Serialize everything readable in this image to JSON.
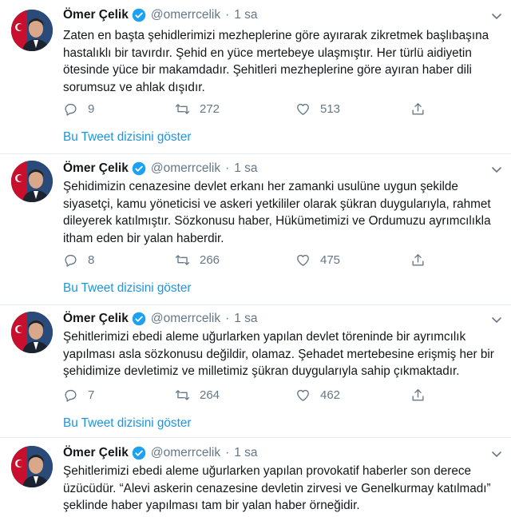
{
  "tweets": [
    {
      "name": "Ömer Çelik",
      "handle": "@omerrcelik",
      "separator": "·",
      "time": "1 sa",
      "text": "Zaten en başta şehidlerimizi mezheplerine göre ayırarak zikretmek başlıbaşına hastalıklı bir tavırdır. Şehid en yüce mertebeye ulaşmıştır. Her türlü aidiyetin ötesinde yüce bir makamdadır. Şehitleri mezheplerine göre ayıran  haber dili sorumsuz ve ahlak dışıdır.",
      "replies": "9",
      "retweets": "272",
      "likes": "513",
      "thread_link": "Bu Tweet dizisini göster"
    },
    {
      "name": "Ömer Çelik",
      "handle": "@omerrcelik",
      "separator": "·",
      "time": "1 sa",
      "text": "Şehidimizin cenazesine devlet erkanı her zamanki usulüne uygun şekilde siyasetçi, kamu yöneticisi ve askeri yetkililer olarak şükran duygularıyla, rahmet dileyerek katılmıştır. Sözkonusu haber, Hükümetimizi ve Ordumuzu ayrımcılıkla itham eden bir yalan haberdir.",
      "replies": "8",
      "retweets": "266",
      "likes": "475",
      "thread_link": "Bu Tweet dizisini göster"
    },
    {
      "name": "Ömer Çelik",
      "handle": "@omerrcelik",
      "separator": "·",
      "time": "1 sa",
      "text": "Şehitlerimizi ebedi aleme uğurlarken yapılan devlet töreninde bir ayrımcılık yapılması asla sözkonusu değildir, olamaz. Şehadet mertebesine erişmiş her bir şehidimize devletimiz ve milletimiz şükran duygularıyla sahip çıkmaktadır.",
      "replies": "7",
      "retweets": "264",
      "likes": "462",
      "thread_link": "Bu Tweet dizisini göster"
    },
    {
      "name": "Ömer Çelik",
      "handle": "@omerrcelik",
      "separator": "·",
      "time": "1 sa",
      "text": "Şehitlerimizi ebedi aleme uğurlarken yapılan provokatif haberler son derece üzücüdür. “Alevi askerin cenazesine devletin zirvesi ve Genelkurmay katılmadı” şeklinde haber yapılması tam bir yalan haber örneğidir."
    }
  ],
  "icons": {
    "verified": "verified-badge-icon",
    "reply": "reply-icon",
    "retweet": "retweet-icon",
    "like": "heart-icon",
    "share": "share-icon",
    "more": "chevron-down-icon"
  },
  "colors": {
    "accent": "#1b95e0",
    "muted": "#657786",
    "text": "#14171a",
    "divider": "#e6ecf0"
  }
}
